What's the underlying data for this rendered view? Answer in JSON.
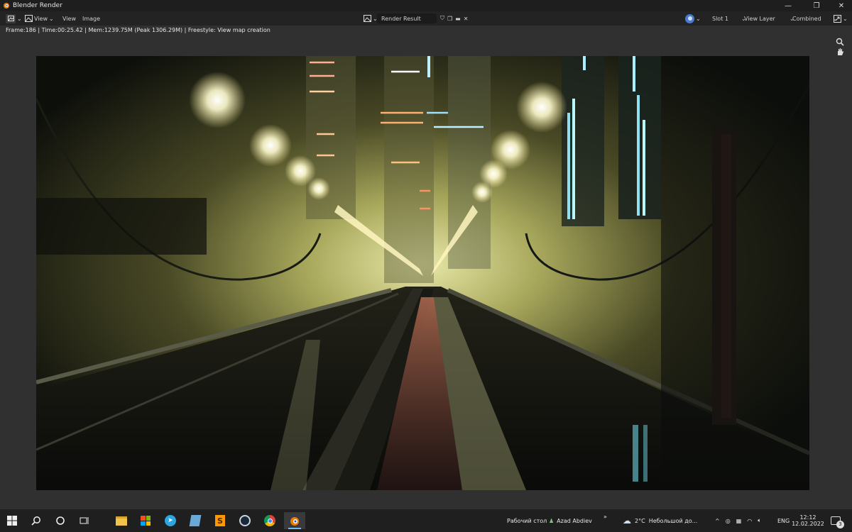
{
  "window": {
    "title": "Blender Render"
  },
  "header": {
    "menu": [
      "View",
      "View",
      "Image"
    ],
    "image_name": "Render Result",
    "slot": "Slot 1",
    "view_layer": "View Layer",
    "pass": "Combined"
  },
  "status_line": "Frame:186 | Time:00:25.42 | Mem:1239.75M (Peak 1306.29M) | Freestyle: View map creation",
  "taskbar": {
    "desktop_label": "Рабочий стол",
    "user_name": "Azad Abdiev",
    "weather_temp": "2°C",
    "weather_text": "Небольшой до...",
    "language": "ENG",
    "time": "12:12",
    "date": "12.02.2022",
    "notification_count": "3",
    "pinned_apps": [
      "file-explorer-icon",
      "store-icon",
      "telegram-icon",
      "notes-icon",
      "sublime-icon",
      "steam-icon",
      "chrome-icon",
      "blender-icon"
    ]
  },
  "colors": {
    "accent": "#76b9ed",
    "blender_orange": "#e87d0d",
    "background": "#303030"
  }
}
